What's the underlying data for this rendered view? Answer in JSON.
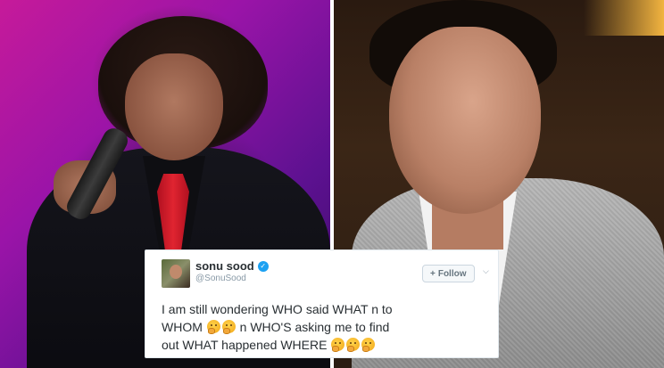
{
  "tweet": {
    "display_name": "sonu sood",
    "handle": "@SonuSood",
    "follow_label": "Follow",
    "follow_icon": "+",
    "line1": "I am still wondering WHO said WHAT n to",
    "line2_a": "WHOM",
    "line2_b": "n WHO'S  asking me to find",
    "line3_a": "out WHAT happened WHERE"
  },
  "icons": {
    "verified": "verified-badge-icon",
    "follow": "add-person-icon",
    "menu": "chevron-down-icon",
    "emoji": "thinking-face-emoji"
  },
  "colors": {
    "accent": "#1da1f2",
    "text": "#292f33",
    "muted": "#8899a6"
  }
}
